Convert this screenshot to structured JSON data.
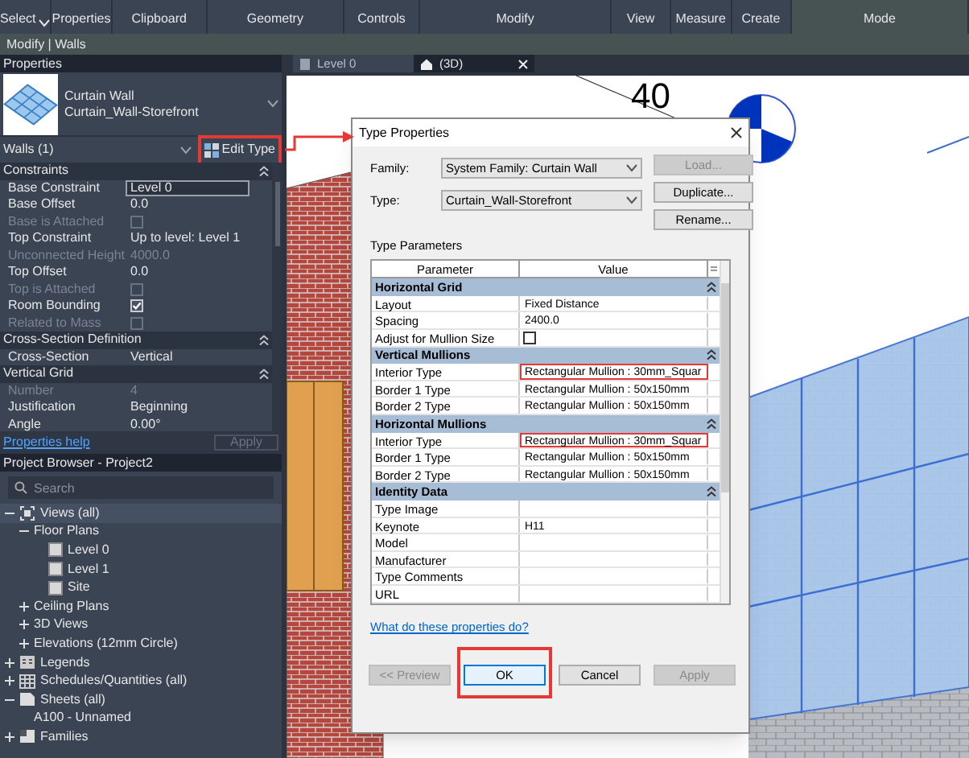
{
  "ribbon": {
    "panels": [
      {
        "label": "Select",
        "menu": true
      },
      {
        "label": "Properties",
        "menu": false
      },
      {
        "label": "Clipboard",
        "menu": false
      },
      {
        "label": "Geometry",
        "menu": false
      },
      {
        "label": "Controls",
        "menu": false
      },
      {
        "label": "Modify",
        "menu": false
      },
      {
        "label": "View",
        "menu": false
      },
      {
        "label": "Measure",
        "menu": false
      },
      {
        "label": "Create",
        "menu": false
      },
      {
        "label": "Mode",
        "menu": false
      }
    ]
  },
  "context_bar": "Modify | Walls",
  "properties": {
    "title": "Properties",
    "type_family": "Curtain Wall",
    "type_name": "Curtain_Wall-Storefront",
    "filter": "Walls (1)",
    "edit_type": {
      "label": "Edit Type",
      "highlighted": true
    },
    "rows": [
      {
        "kind": "section",
        "label": "Constraints"
      },
      {
        "kind": "text",
        "label": "Base Constraint",
        "value": "Level 0",
        "disabled": false,
        "editing": true
      },
      {
        "kind": "text",
        "label": "Base Offset",
        "value": "0.0",
        "disabled": false,
        "editing": false
      },
      {
        "kind": "checkbox",
        "label": "Base is Attached",
        "checked": false,
        "disabled": true
      },
      {
        "kind": "text",
        "label": "Top Constraint",
        "value": "Up to level: Level 1",
        "disabled": false,
        "editing": false
      },
      {
        "kind": "text",
        "label": "Unconnected Height",
        "value": "4000.0",
        "disabled": true,
        "editing": false
      },
      {
        "kind": "text",
        "label": "Top Offset",
        "value": "0.0",
        "disabled": false,
        "editing": false
      },
      {
        "kind": "checkbox",
        "label": "Top is Attached",
        "checked": false,
        "disabled": true
      },
      {
        "kind": "checkbox",
        "label": "Room Bounding",
        "checked": true,
        "disabled": false
      },
      {
        "kind": "checkbox",
        "label": "Related to Mass",
        "checked": false,
        "disabled": true
      },
      {
        "kind": "section",
        "label": "Cross-Section Definition"
      },
      {
        "kind": "text",
        "label": "Cross-Section",
        "value": "Vertical",
        "disabled": false,
        "editing": false
      },
      {
        "kind": "section",
        "label": "Vertical Grid"
      },
      {
        "kind": "text",
        "label": "Number",
        "value": "4",
        "disabled": true,
        "editing": false
      },
      {
        "kind": "text",
        "label": "Justification",
        "value": "Beginning",
        "disabled": false,
        "editing": false
      },
      {
        "kind": "text",
        "label": "Angle",
        "value": "0.00°",
        "disabled": false,
        "editing": false
      }
    ],
    "help_link": "Properties help",
    "apply": {
      "label": "Apply",
      "disabled": true
    }
  },
  "project_browser": {
    "title": "Project Browser - Project2",
    "search": {
      "placeholder": "Search"
    },
    "tree": [
      {
        "label": "Views (all)",
        "kind": "views",
        "expanded": true,
        "selected": true,
        "children": [
          {
            "label": "Floor Plans",
            "expanded": true,
            "selected": false,
            "children": [
              {
                "label": "Level 0",
                "kind": "view",
                "selected": false
              },
              {
                "label": "Level 1",
                "kind": "view",
                "selected": false
              },
              {
                "label": "Site",
                "kind": "view",
                "selected": false
              }
            ]
          },
          {
            "label": "Ceiling Plans",
            "expanded": false,
            "selected": false
          },
          {
            "label": "3D Views",
            "expanded": false,
            "selected": false
          },
          {
            "label": "Elevations (12mm Circle)",
            "expanded": false,
            "selected": false
          }
        ]
      },
      {
        "label": "Legends",
        "kind": "legend",
        "expanded": false,
        "selected": false
      },
      {
        "label": "Schedules/Quantities (all)",
        "kind": "schedule",
        "expanded": false,
        "selected": false
      },
      {
        "label": "Sheets (all)",
        "kind": "sheet",
        "expanded": true,
        "selected": false,
        "children": [
          {
            "label": "A100 - Unnamed",
            "selected": false
          }
        ]
      },
      {
        "label": "Families",
        "kind": "family",
        "expanded": false,
        "selected": false
      }
    ]
  },
  "view_tabs": [
    {
      "label": "Level 0",
      "kind": "plan",
      "selected": false,
      "closable": false
    },
    {
      "label": "(3D)",
      "kind": "home",
      "selected": true,
      "closable": true
    }
  ],
  "canvas": {
    "dimension_text": "40"
  },
  "dialog": {
    "title": "Type Properties",
    "family": {
      "label": "Family:",
      "value": "System Family: Curtain Wall"
    },
    "type": {
      "label": "Type:",
      "value": "Curtain_Wall-Storefront"
    },
    "side_buttons": [
      {
        "label": "Load...",
        "disabled": true
      },
      {
        "label": "Duplicate...",
        "disabled": false
      },
      {
        "label": "Rename...",
        "disabled": false
      }
    ],
    "params_label": "Type Parameters",
    "columns": [
      "Parameter",
      "Value"
    ],
    "rows": [
      {
        "kind": "section",
        "label": "Horizontal Grid"
      },
      {
        "kind": "text",
        "label": "Layout",
        "value": "Fixed Distance",
        "highlighted": false
      },
      {
        "kind": "text",
        "label": "Spacing",
        "value": "2400.0",
        "highlighted": false
      },
      {
        "kind": "checkbox",
        "label": "Adjust for Mullion Size",
        "checked": false
      },
      {
        "kind": "section",
        "label": "Vertical Mullions"
      },
      {
        "kind": "text",
        "label": "Interior Type",
        "value": "Rectangular Mullion : 30mm_Squar",
        "highlighted": true
      },
      {
        "kind": "text",
        "label": "Border 1 Type",
        "value": "Rectangular Mullion : 50x150mm",
        "highlighted": false
      },
      {
        "kind": "text",
        "label": "Border 2 Type",
        "value": "Rectangular Mullion : 50x150mm",
        "highlighted": false
      },
      {
        "kind": "section",
        "label": "Horizontal Mullions"
      },
      {
        "kind": "text",
        "label": "Interior Type",
        "value": "Rectangular Mullion : 30mm_Squar",
        "highlighted": true
      },
      {
        "kind": "text",
        "label": "Border 1 Type",
        "value": "Rectangular Mullion : 50x150mm",
        "highlighted": false
      },
      {
        "kind": "text",
        "label": "Border 2 Type",
        "value": "Rectangular Mullion : 50x150mm",
        "highlighted": false
      },
      {
        "kind": "section",
        "label": "Identity Data"
      },
      {
        "kind": "text",
        "label": "Type Image",
        "highlighted": false
      },
      {
        "kind": "text",
        "label": "Keynote",
        "value": "H11",
        "highlighted": false
      },
      {
        "kind": "text",
        "label": "Model",
        "highlighted": false
      },
      {
        "kind": "text",
        "label": "Manufacturer",
        "highlighted": false
      },
      {
        "kind": "text",
        "label": "Type Comments",
        "highlighted": false
      },
      {
        "kind": "text",
        "label": "URL",
        "highlighted": false
      }
    ],
    "help_link": "What do these properties do?",
    "buttons": [
      {
        "label": "<< Preview",
        "disabled": true,
        "highlighted": false
      },
      {
        "label": "OK",
        "disabled": false,
        "highlighted": true
      },
      {
        "label": "Cancel",
        "disabled": false,
        "highlighted": false
      },
      {
        "label": "Apply",
        "disabled": true,
        "highlighted": false
      }
    ]
  }
}
